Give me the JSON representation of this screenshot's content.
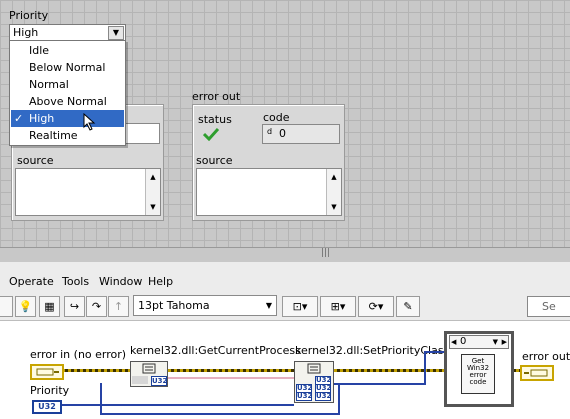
{
  "front_panel": {
    "priority_label": "Priority",
    "priority_value": "High",
    "priority_options": [
      "Idle",
      "Below Normal",
      "Normal",
      "Above Normal",
      "High",
      "Realtime"
    ],
    "selected_option": "High",
    "error_out_label": "error out",
    "status_label": "status",
    "code_label": "code",
    "code_radix": "d",
    "code_value": "0",
    "source_label": "source",
    "left_source_label": "source"
  },
  "menu_bar": {
    "items": [
      "Operate",
      "Tools",
      "Window",
      "Help"
    ]
  },
  "toolbar": {
    "font_value": "13pt Tahoma",
    "search_placeholder": "Se"
  },
  "block_diagram": {
    "error_in_label": "error in (no error)",
    "priority_label": "Priority",
    "priority_type": "U32",
    "get_process_label": "kernel32.dll:GetCurrentProcess",
    "set_priority_label": "kernel32.dll:SetPriorityClass",
    "case_selector": "0",
    "subvi_text": "Get Win32 error code",
    "error_out_label": "error out",
    "u32": "U32"
  },
  "colors": {
    "fp_background": "#c8c8c8",
    "selection": "#316ac5",
    "error_wire": "#c2a000",
    "int_wire": "#2643a5",
    "ptr_wire": "#e5b0c0"
  }
}
